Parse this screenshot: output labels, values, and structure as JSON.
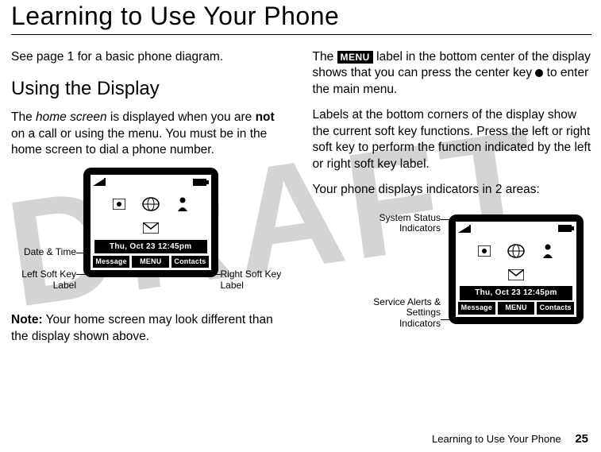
{
  "title": "Learning to Use Your Phone",
  "watermark": "DRAFT",
  "left_col": {
    "intro": "See page 1 for a basic phone diagram.",
    "section_heading": "Using the Display",
    "para1_a": "The ",
    "para1_term": "home screen",
    "para1_b": " is displayed when you are ",
    "para1_bold": "not",
    "para1_c": " on a call or using the menu. You must be in the home screen to dial a phone number.",
    "note_bold": "Note:",
    "note_text": " Your home screen may look different than the display shown above."
  },
  "right_col": {
    "para1_a": "The ",
    "para1_chip": "MENU",
    "para1_b": " label in the bottom center of the display shows that you can press the center key ",
    "para1_c": " to enter the main menu.",
    "para2": "Labels at the bottom corners of the display show the current soft key functions. Press the left or right soft key to perform the function indicated by the left or right soft key label.",
    "para3": "Your phone displays indicators in 2 areas:"
  },
  "screen": {
    "datetime": "Thu, Oct 23 12:45pm",
    "soft_left": "Message",
    "soft_center": "MENU",
    "soft_right": "Contacts"
  },
  "callouts_left_fig": {
    "date_time": "Date & Time",
    "left_soft_key_l1": "Left Soft Key",
    "left_soft_key_l2": "Label",
    "right_soft_key_l1": "Right Soft Key",
    "right_soft_key_l2": "Label"
  },
  "callouts_right_fig": {
    "sys_l1": "System Status",
    "sys_l2": "Indicators",
    "alerts_l1": "Service Alerts &",
    "alerts_l2": "Settings",
    "alerts_l3": "Indicators"
  },
  "footer": {
    "text": "Learning to Use Your Phone",
    "page": "25"
  }
}
